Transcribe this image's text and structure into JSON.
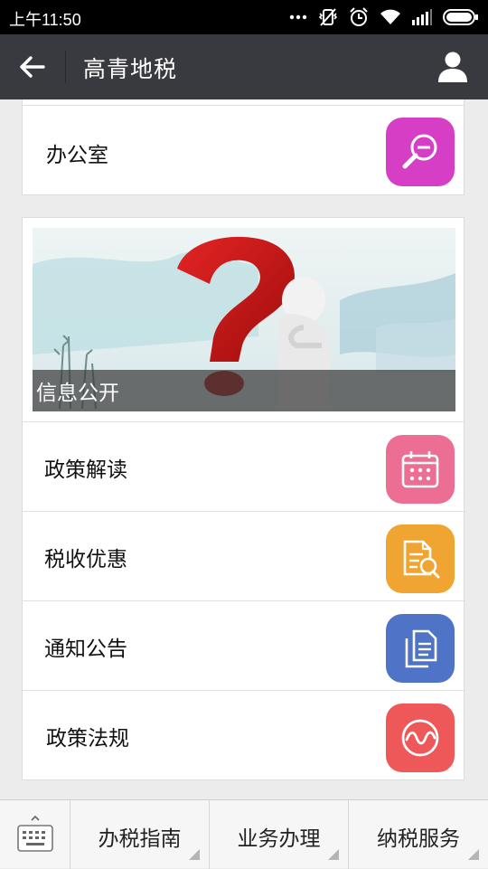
{
  "status_bar": {
    "time": "上午11:50",
    "icons": [
      "more-dots-icon",
      "vibrate-off-icon",
      "alarm-icon",
      "wifi-icon",
      "signal-icon",
      "battery-icon"
    ]
  },
  "header": {
    "title": "高青地税",
    "back_icon": "back-arrow-icon",
    "profile_icon": "person-icon"
  },
  "top_card": {
    "item": {
      "label": "办公室",
      "icon": "search-zoom-out-icon",
      "color": "#d63ec6"
    }
  },
  "info_card": {
    "banner_caption": "信息公开",
    "items": [
      {
        "label": "政策解读",
        "icon": "calendar-icon",
        "color": "#ec6e92"
      },
      {
        "label": "税收优惠",
        "icon": "document-search-icon",
        "color": "#f0a431"
      },
      {
        "label": "通知公告",
        "icon": "copy-documents-icon",
        "color": "#4f73c6"
      },
      {
        "label": "政策法规",
        "icon": "wave-chart-icon",
        "color": "#ef5858"
      }
    ]
  },
  "bottom_menu": {
    "keyboard_icon": "keyboard-icon",
    "items": [
      {
        "label": "办税指南"
      },
      {
        "label": "业务办理"
      },
      {
        "label": "纳税服务"
      }
    ]
  }
}
